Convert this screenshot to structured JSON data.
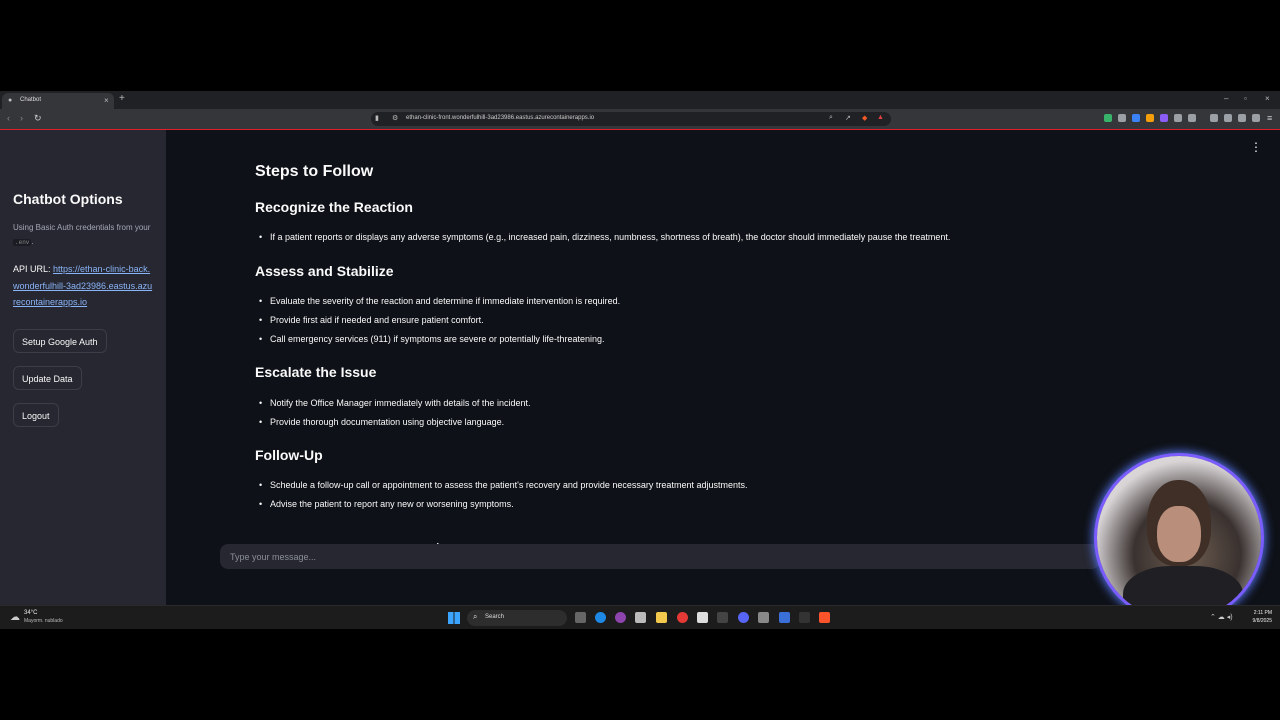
{
  "browser": {
    "tab_title": "Chatbot",
    "url": "ethan-clinic-front.wonderfulhill-3ad23986.eastus.azurecontainerapps.io",
    "accent_color": "#e0202a"
  },
  "sidebar": {
    "title": "Chatbot Options",
    "note_prefix": "Using Basic Auth credentials from your",
    "note_code": ".env",
    "note_suffix": ".",
    "api_label": "API URL:",
    "api_url": "https://ethan-clinic-back.wonderfulhill-3ad23986.eastus.azurecontainerapps.io",
    "buttons": [
      "Setup Google Auth",
      "Update Data",
      "Logout"
    ]
  },
  "content": {
    "top_heading": "Steps to Follow",
    "sections": [
      {
        "heading": "Recognize the Reaction",
        "items": [
          "If a patient reports or displays any adverse symptoms (e.g., increased pain, dizziness, numbness, shortness of breath), the doctor should immediately pause the treatment."
        ]
      },
      {
        "heading": "Assess and Stabilize",
        "items": [
          "Evaluate the severity of the reaction and determine if immediate intervention is required.",
          "Provide first aid if needed and ensure patient comfort.",
          "Call emergency services (911) if symptoms are severe or potentially life-threatening."
        ]
      },
      {
        "heading": "Escalate the Issue",
        "items": [
          "Notify the Office Manager immediately with details of the incident.",
          "Provide thorough documentation using objective language."
        ]
      },
      {
        "heading": "Follow-Up",
        "items": [
          "Schedule a follow-up call or appointment to assess the patient's recovery and provide necessary treatment adjustments.",
          "Advise the patient to report any new or worsening symptoms."
        ]
      }
    ]
  },
  "chat": {
    "placeholder": "Type your message..."
  },
  "taskbar": {
    "weather_temp": "34°C",
    "weather_desc": "Mayorm. nublado",
    "search_label": "Search",
    "time": "2:11 PM",
    "date": "9/8/2025"
  }
}
